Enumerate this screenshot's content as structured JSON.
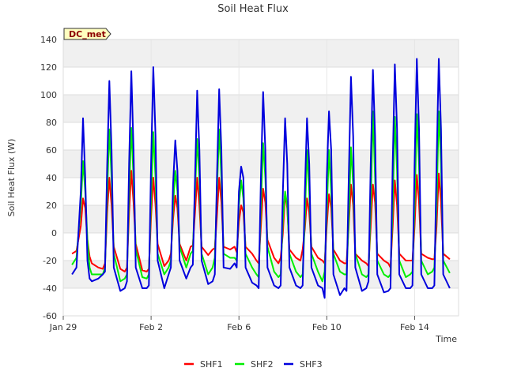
{
  "chart_data": {
    "type": "line",
    "title": "Soil Heat Flux",
    "xlabel": "Time",
    "ylabel": "Soil Heat Flux (W)",
    "badge": "DC_met",
    "ylim": [
      -60,
      140
    ],
    "yticks": [
      -60,
      -40,
      -20,
      0,
      20,
      40,
      60,
      80,
      100,
      120,
      140
    ],
    "xlim": [
      0,
      18
    ],
    "xticks": [
      {
        "value": 0,
        "label": "Jan 29"
      },
      {
        "value": 4,
        "label": "Feb 2"
      },
      {
        "value": 8,
        "label": "Feb 6"
      },
      {
        "value": 12,
        "label": "Feb 10"
      },
      {
        "value": 16,
        "label": "Feb 14"
      }
    ],
    "grid": true,
    "legend_position": "bottom",
    "series": [
      {
        "name": "SHF1",
        "color": "#ff0000",
        "x": [
          0.4,
          0.6,
          0.8,
          0.9,
          1.0,
          1.1,
          1.2,
          1.3,
          1.6,
          1.8,
          1.9,
          2.0,
          2.1,
          2.2,
          2.3,
          2.6,
          2.8,
          2.9,
          3.0,
          3.1,
          3.2,
          3.3,
          3.6,
          3.8,
          3.9,
          4.0,
          4.1,
          4.2,
          4.3,
          4.6,
          4.8,
          4.9,
          5.0,
          5.1,
          5.2,
          5.3,
          5.6,
          5.8,
          5.9,
          6.0,
          6.1,
          6.2,
          6.3,
          6.6,
          6.8,
          6.9,
          7.0,
          7.1,
          7.2,
          7.3,
          7.6,
          7.8,
          7.9,
          8.0,
          8.1,
          8.2,
          8.3,
          8.6,
          8.8,
          8.9,
          9.0,
          9.1,
          9.2,
          9.3,
          9.6,
          9.8,
          9.9,
          10.0,
          10.1,
          10.2,
          10.3,
          10.6,
          10.8,
          10.9,
          11.0,
          11.1,
          11.2,
          11.3,
          11.6,
          11.8,
          11.9,
          12.0,
          12.1,
          12.2,
          12.3,
          12.6,
          12.8,
          12.9,
          13.0,
          13.1,
          13.2,
          13.3,
          13.6,
          13.8,
          13.9,
          14.0,
          14.1,
          14.2,
          14.3,
          14.6,
          14.8,
          14.9,
          15.0,
          15.1,
          15.2,
          15.3,
          15.6,
          15.8,
          15.9,
          16.0,
          16.1,
          16.2,
          16.3,
          16.6,
          16.8,
          16.9,
          17.0,
          17.1,
          17.2,
          17.3,
          17.6
        ],
        "values": [
          -15,
          -13,
          5,
          25,
          18,
          -5,
          -17,
          -22,
          -25,
          -26,
          -22,
          15,
          40,
          20,
          -10,
          -26,
          -28,
          -25,
          15,
          45,
          22,
          -8,
          -27,
          -28,
          -26,
          12,
          40,
          20,
          -8,
          -24,
          -20,
          -15,
          10,
          27,
          18,
          -8,
          -20,
          -10,
          -9,
          15,
          40,
          20,
          -10,
          -16,
          -12,
          -11,
          12,
          40,
          22,
          -10,
          -12,
          -10,
          -14,
          8,
          20,
          15,
          -10,
          -15,
          -20,
          -22,
          5,
          32,
          22,
          -5,
          -18,
          -22,
          -18,
          0,
          28,
          18,
          -12,
          -18,
          -20,
          -12,
          3,
          25,
          15,
          -10,
          -18,
          -20,
          -22,
          5,
          28,
          18,
          -12,
          -20,
          -22,
          -22,
          5,
          35,
          20,
          -15,
          -20,
          -22,
          -24,
          5,
          35,
          22,
          -15,
          -20,
          -22,
          -25,
          5,
          38,
          20,
          -15,
          -20,
          -20,
          -20,
          5,
          42,
          22,
          -15,
          -18,
          -19,
          -19,
          5,
          43,
          22,
          -15,
          -19
        ]
      },
      {
        "name": "SHF2",
        "color": "#00ee00",
        "x": [
          0.4,
          0.6,
          0.8,
          0.9,
          1.0,
          1.1,
          1.2,
          1.3,
          1.6,
          1.8,
          1.9,
          2.0,
          2.1,
          2.2,
          2.3,
          2.6,
          2.8,
          2.9,
          3.0,
          3.1,
          3.2,
          3.3,
          3.6,
          3.8,
          3.9,
          4.0,
          4.1,
          4.2,
          4.3,
          4.6,
          4.8,
          4.9,
          5.0,
          5.1,
          5.2,
          5.3,
          5.6,
          5.8,
          5.9,
          6.0,
          6.1,
          6.2,
          6.3,
          6.6,
          6.8,
          6.9,
          7.0,
          7.1,
          7.2,
          7.3,
          7.6,
          7.8,
          7.9,
          8.0,
          8.1,
          8.2,
          8.3,
          8.6,
          8.8,
          8.9,
          9.0,
          9.1,
          9.2,
          9.3,
          9.6,
          9.8,
          9.9,
          10.0,
          10.1,
          10.2,
          10.3,
          10.6,
          10.8,
          10.9,
          11.0,
          11.1,
          11.2,
          11.3,
          11.6,
          11.8,
          11.9,
          12.0,
          12.1,
          12.2,
          12.3,
          12.6,
          12.8,
          12.9,
          13.0,
          13.1,
          13.2,
          13.3,
          13.6,
          13.8,
          13.9,
          14.0,
          14.1,
          14.2,
          14.3,
          14.6,
          14.8,
          14.9,
          15.0,
          15.1,
          15.2,
          15.3,
          15.6,
          15.8,
          15.9,
          16.0,
          16.1,
          16.2,
          16.3,
          16.6,
          16.8,
          16.9,
          17.0,
          17.1,
          17.2,
          17.3,
          17.6
        ],
        "values": [
          -23,
          -18,
          20,
          52,
          30,
          -5,
          -25,
          -30,
          -30,
          -30,
          -25,
          30,
          75,
          40,
          -15,
          -35,
          -33,
          -30,
          30,
          76,
          40,
          -12,
          -32,
          -33,
          -30,
          25,
          73,
          40,
          -15,
          -30,
          -25,
          -20,
          20,
          45,
          30,
          -10,
          -25,
          -15,
          -13,
          30,
          68,
          40,
          -15,
          -30,
          -25,
          -18,
          30,
          75,
          40,
          -15,
          -18,
          -18,
          -20,
          20,
          38,
          25,
          -15,
          -25,
          -30,
          -32,
          20,
          65,
          40,
          -10,
          -28,
          -32,
          -30,
          10,
          30,
          20,
          -15,
          -28,
          -32,
          -30,
          10,
          60,
          30,
          -15,
          -28,
          -35,
          -28,
          15,
          60,
          30,
          -15,
          -28,
          -30,
          -30,
          10,
          62,
          35,
          -15,
          -30,
          -32,
          -30,
          20,
          88,
          40,
          -20,
          -30,
          -32,
          -30,
          20,
          84,
          45,
          -20,
          -32,
          -30,
          -28,
          20,
          86,
          50,
          -20,
          -30,
          -28,
          -25,
          20,
          88,
          50,
          -20,
          -29
        ]
      },
      {
        "name": "SHF3",
        "color": "#0000dd",
        "x": [
          0.4,
          0.6,
          0.8,
          0.9,
          1.0,
          1.1,
          1.2,
          1.3,
          1.6,
          1.8,
          1.9,
          2.0,
          2.1,
          2.2,
          2.3,
          2.6,
          2.8,
          2.9,
          3.0,
          3.1,
          3.2,
          3.3,
          3.6,
          3.8,
          3.9,
          4.0,
          4.1,
          4.2,
          4.3,
          4.6,
          4.8,
          4.9,
          5.0,
          5.1,
          5.2,
          5.3,
          5.6,
          5.8,
          5.9,
          6.0,
          6.1,
          6.2,
          6.3,
          6.6,
          6.8,
          6.9,
          7.0,
          7.1,
          7.2,
          7.3,
          7.6,
          7.8,
          7.9,
          8.0,
          8.1,
          8.2,
          8.3,
          8.6,
          8.8,
          8.9,
          9.0,
          9.1,
          9.2,
          9.3,
          9.6,
          9.8,
          9.9,
          10.0,
          10.1,
          10.2,
          10.3,
          10.6,
          10.8,
          10.9,
          11.0,
          11.1,
          11.2,
          11.3,
          11.6,
          11.8,
          11.9,
          12.0,
          12.1,
          12.2,
          12.3,
          12.6,
          12.8,
          12.9,
          13.0,
          13.1,
          13.2,
          13.3,
          13.6,
          13.8,
          13.9,
          14.0,
          14.1,
          14.2,
          14.3,
          14.6,
          14.8,
          14.9,
          15.0,
          15.1,
          15.2,
          15.3,
          15.6,
          15.8,
          15.9,
          16.0,
          16.1,
          16.2,
          16.3,
          16.6,
          16.8,
          16.9,
          17.0,
          17.1,
          17.2,
          17.3,
          17.6
        ],
        "values": [
          -30,
          -25,
          30,
          83,
          40,
          -20,
          -33,
          -35,
          -33,
          -30,
          -28,
          50,
          110,
          60,
          -25,
          -42,
          -40,
          -35,
          50,
          117,
          60,
          -25,
          -40,
          -40,
          -38,
          50,
          120,
          70,
          -20,
          -40,
          -30,
          -25,
          35,
          67,
          45,
          -20,
          -33,
          -25,
          -23,
          40,
          103,
          60,
          -20,
          -37,
          -35,
          -30,
          40,
          104,
          60,
          -25,
          -26,
          -22,
          -25,
          30,
          48,
          40,
          -25,
          -36,
          -38,
          -40,
          40,
          102,
          60,
          -25,
          -38,
          -40,
          -38,
          30,
          83,
          50,
          -25,
          -38,
          -40,
          -38,
          30,
          83,
          50,
          -25,
          -38,
          -40,
          -47,
          40,
          88,
          60,
          -30,
          -45,
          -40,
          -42,
          40,
          113,
          70,
          -25,
          -42,
          -40,
          -35,
          50,
          118,
          70,
          -30,
          -43,
          -42,
          -40,
          50,
          122,
          75,
          -30,
          -40,
          -40,
          -38,
          50,
          126,
          75,
          -30,
          -40,
          -40,
          -38,
          50,
          126,
          75,
          -30,
          -40
        ]
      }
    ]
  }
}
